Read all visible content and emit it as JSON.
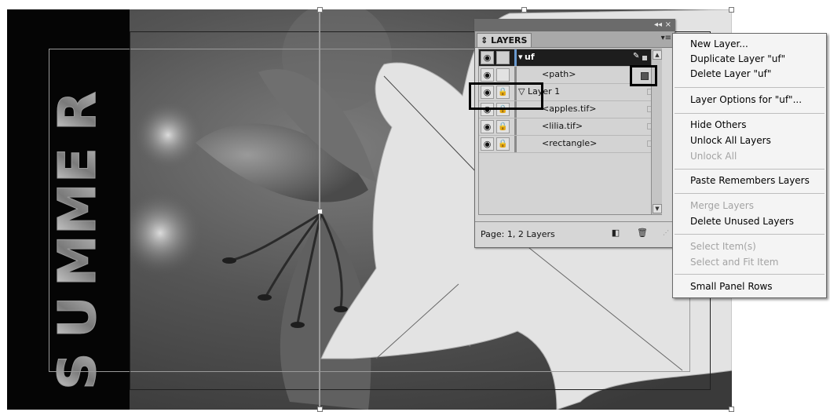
{
  "artwork": {
    "title_letters": [
      "S",
      "U",
      "M",
      "M",
      "E",
      "R"
    ]
  },
  "layers_panel": {
    "tab_label": "LAYERS",
    "collapse_label": "◂◂",
    "close_label": "×",
    "menu_label": "▾≡",
    "layers": [
      {
        "name": "uf",
        "expanded": true,
        "is_layer": true,
        "selected": true
      },
      {
        "name": "<path>",
        "is_layer": false
      },
      {
        "name": "Layer 1",
        "is_layer": true,
        "expanded": true
      },
      {
        "name": "<apples.tif>",
        "is_layer": false
      },
      {
        "name": "<lilia.tif>",
        "is_layer": false
      },
      {
        "name": "<rectangle>",
        "is_layer": false
      }
    ],
    "status_text": "Page: 1, 2 Layers",
    "new_layer_icon": "new-layer-icon",
    "delete_layer_icon": "trash-icon"
  },
  "context_menu": {
    "items": [
      {
        "label": "New Layer...",
        "enabled": true
      },
      {
        "label": "Duplicate Layer \"uf\"",
        "enabled": true
      },
      {
        "label": "Delete Layer \"uf\"",
        "enabled": true
      },
      {
        "label": "Layer Options for \"uf\"...",
        "enabled": true
      },
      {
        "label": "Hide Others",
        "enabled": true
      },
      {
        "label": "Unlock All Layers",
        "enabled": true
      },
      {
        "label": "Unlock All",
        "enabled": false
      },
      {
        "label": "Paste Remembers Layers",
        "enabled": true
      },
      {
        "label": "Merge Layers",
        "enabled": false
      },
      {
        "label": "Delete Unused Layers",
        "enabled": true
      },
      {
        "label": "Select Item(s)",
        "enabled": false
      },
      {
        "label": "Select and Fit Item",
        "enabled": false
      },
      {
        "label": "Small Panel Rows",
        "enabled": true
      }
    ]
  }
}
